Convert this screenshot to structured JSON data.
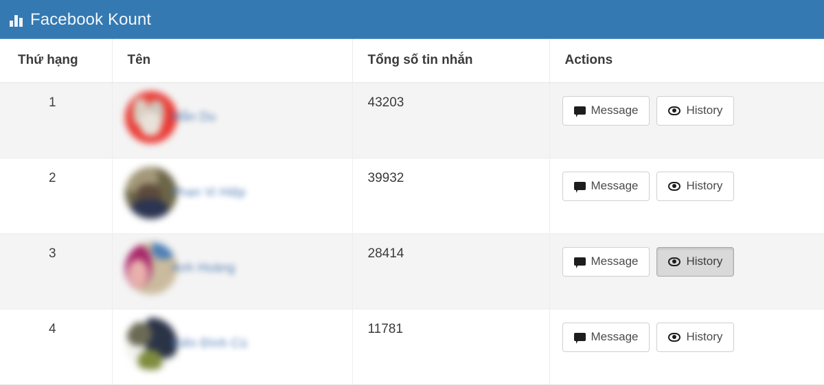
{
  "app": {
    "title": "Facebook Kount",
    "icon": "bar-chart-icon",
    "header_bg": "#3479b2",
    "header_text_color": "#f2f7fb"
  },
  "table": {
    "columns": [
      {
        "key": "rank",
        "label": "Thứ hạng"
      },
      {
        "key": "name",
        "label": "Tên"
      },
      {
        "key": "total",
        "label": "Tổng số tin nhắn"
      },
      {
        "key": "actions",
        "label": "Actions"
      }
    ],
    "rows": [
      {
        "rank": "1",
        "name": "Mẫn Du",
        "name_redacted": true,
        "avatar": {
          "name": "user-avatar",
          "style": "av1",
          "dominant_color": "#ea3b35"
        },
        "total": "43203",
        "buttons": {
          "message": {
            "label": "Message",
            "icon": "comment-icon",
            "active": false
          },
          "history": {
            "label": "History",
            "icon": "eye-icon",
            "active": false
          }
        }
      },
      {
        "rank": "2",
        "name": "Phan Vi Hiệp",
        "name_redacted": true,
        "avatar": {
          "name": "user-avatar",
          "style": "av2",
          "dominant_color": "#6d6648"
        },
        "total": "39932",
        "buttons": {
          "message": {
            "label": "Message",
            "icon": "comment-icon",
            "active": false
          },
          "history": {
            "label": "History",
            "icon": "eye-icon",
            "active": false
          }
        }
      },
      {
        "rank": "3",
        "name": "Anh Hoàng",
        "name_redacted": true,
        "avatar": {
          "name": "user-avatar",
          "style": "av3",
          "dominant_color": "#a8276a"
        },
        "total": "28414",
        "buttons": {
          "message": {
            "label": "Message",
            "icon": "comment-icon",
            "active": false
          },
          "history": {
            "label": "History",
            "icon": "eye-icon",
            "active": true
          }
        }
      },
      {
        "rank": "4",
        "name": "Kiến Đình Cù",
        "name_redacted": true,
        "avatar": {
          "name": "user-avatar",
          "style": "av4",
          "dominant_color": "#2b3347"
        },
        "total": "11781",
        "buttons": {
          "message": {
            "label": "Message",
            "icon": "comment-icon",
            "active": false
          },
          "history": {
            "label": "History",
            "icon": "eye-icon",
            "active": false
          }
        }
      }
    ]
  }
}
